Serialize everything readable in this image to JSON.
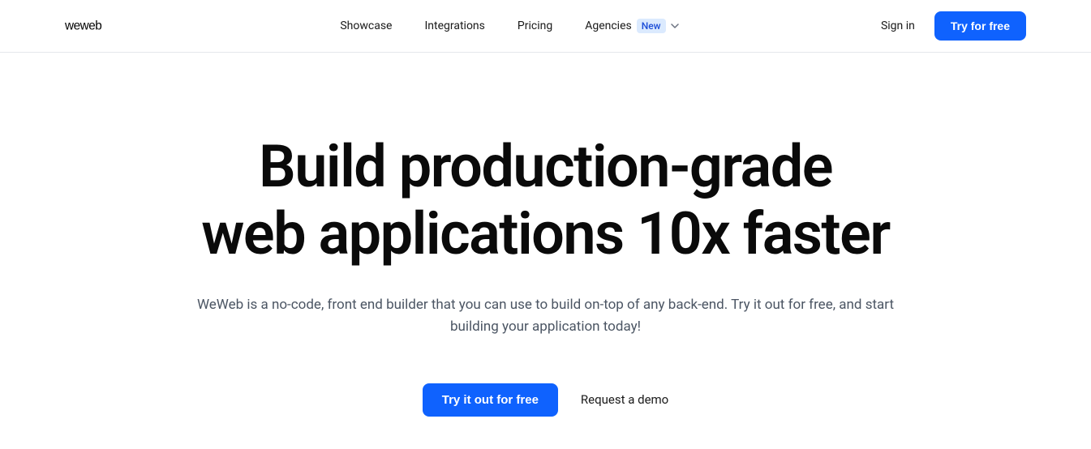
{
  "brand": {
    "name": "weweb"
  },
  "nav": {
    "showcase": "Showcase",
    "integrations": "Integrations",
    "pricing": "Pricing",
    "agencies": "Agencies",
    "agencies_badge": "New"
  },
  "header": {
    "signin": "Sign in",
    "cta": "Try for free"
  },
  "hero": {
    "title_line1": "Build production-grade",
    "title_line2": "web applications 10x faster",
    "subtitle": "WeWeb is a no-code, front end builder that you can use to build on-top of any back-end. Try it out for free, and start building your application today!",
    "primary_cta": "Try it out for free",
    "secondary_cta": "Request a demo"
  }
}
